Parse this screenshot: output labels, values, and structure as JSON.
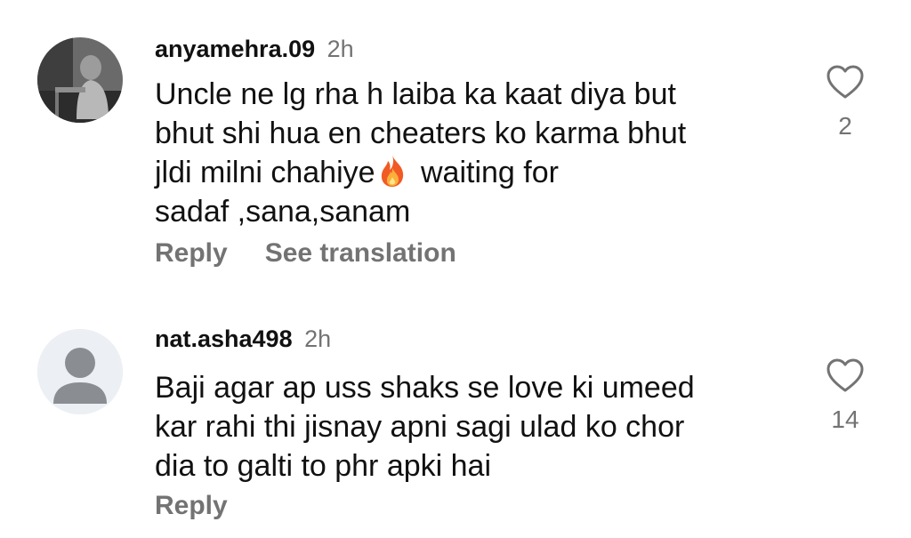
{
  "comments": [
    {
      "username": "anyamehra.09",
      "time": "2h",
      "lines": [
        "Uncle ne lg rha h laiba ka kaat diya but",
        "bhut shi hua en cheaters ko karma bhut",
        "jldi milni chahiye",
        "waiting for",
        "sadaf ,sana,sanam"
      ],
      "emoji": "fire-emoji",
      "likes": "2",
      "reply_label": "Reply",
      "translate_label": "See translation"
    },
    {
      "username": "nat.asha498",
      "time": "2h",
      "lines": [
        "Baji agar ap uss shaks se love ki umeed",
        "kar rahi thi jisnay apni sagi ulad ko chor",
        "dia to galti to phr apki hai"
      ],
      "likes": "14",
      "reply_label": "Reply"
    }
  ],
  "icons": {
    "like": "heart-outline-icon",
    "default_avatar": "person-silhouette-icon"
  },
  "colors": {
    "text": "#111111",
    "secondary": "#737373",
    "avatar_bg": "#eceff3",
    "avatar_figure": "#8a8d92"
  }
}
